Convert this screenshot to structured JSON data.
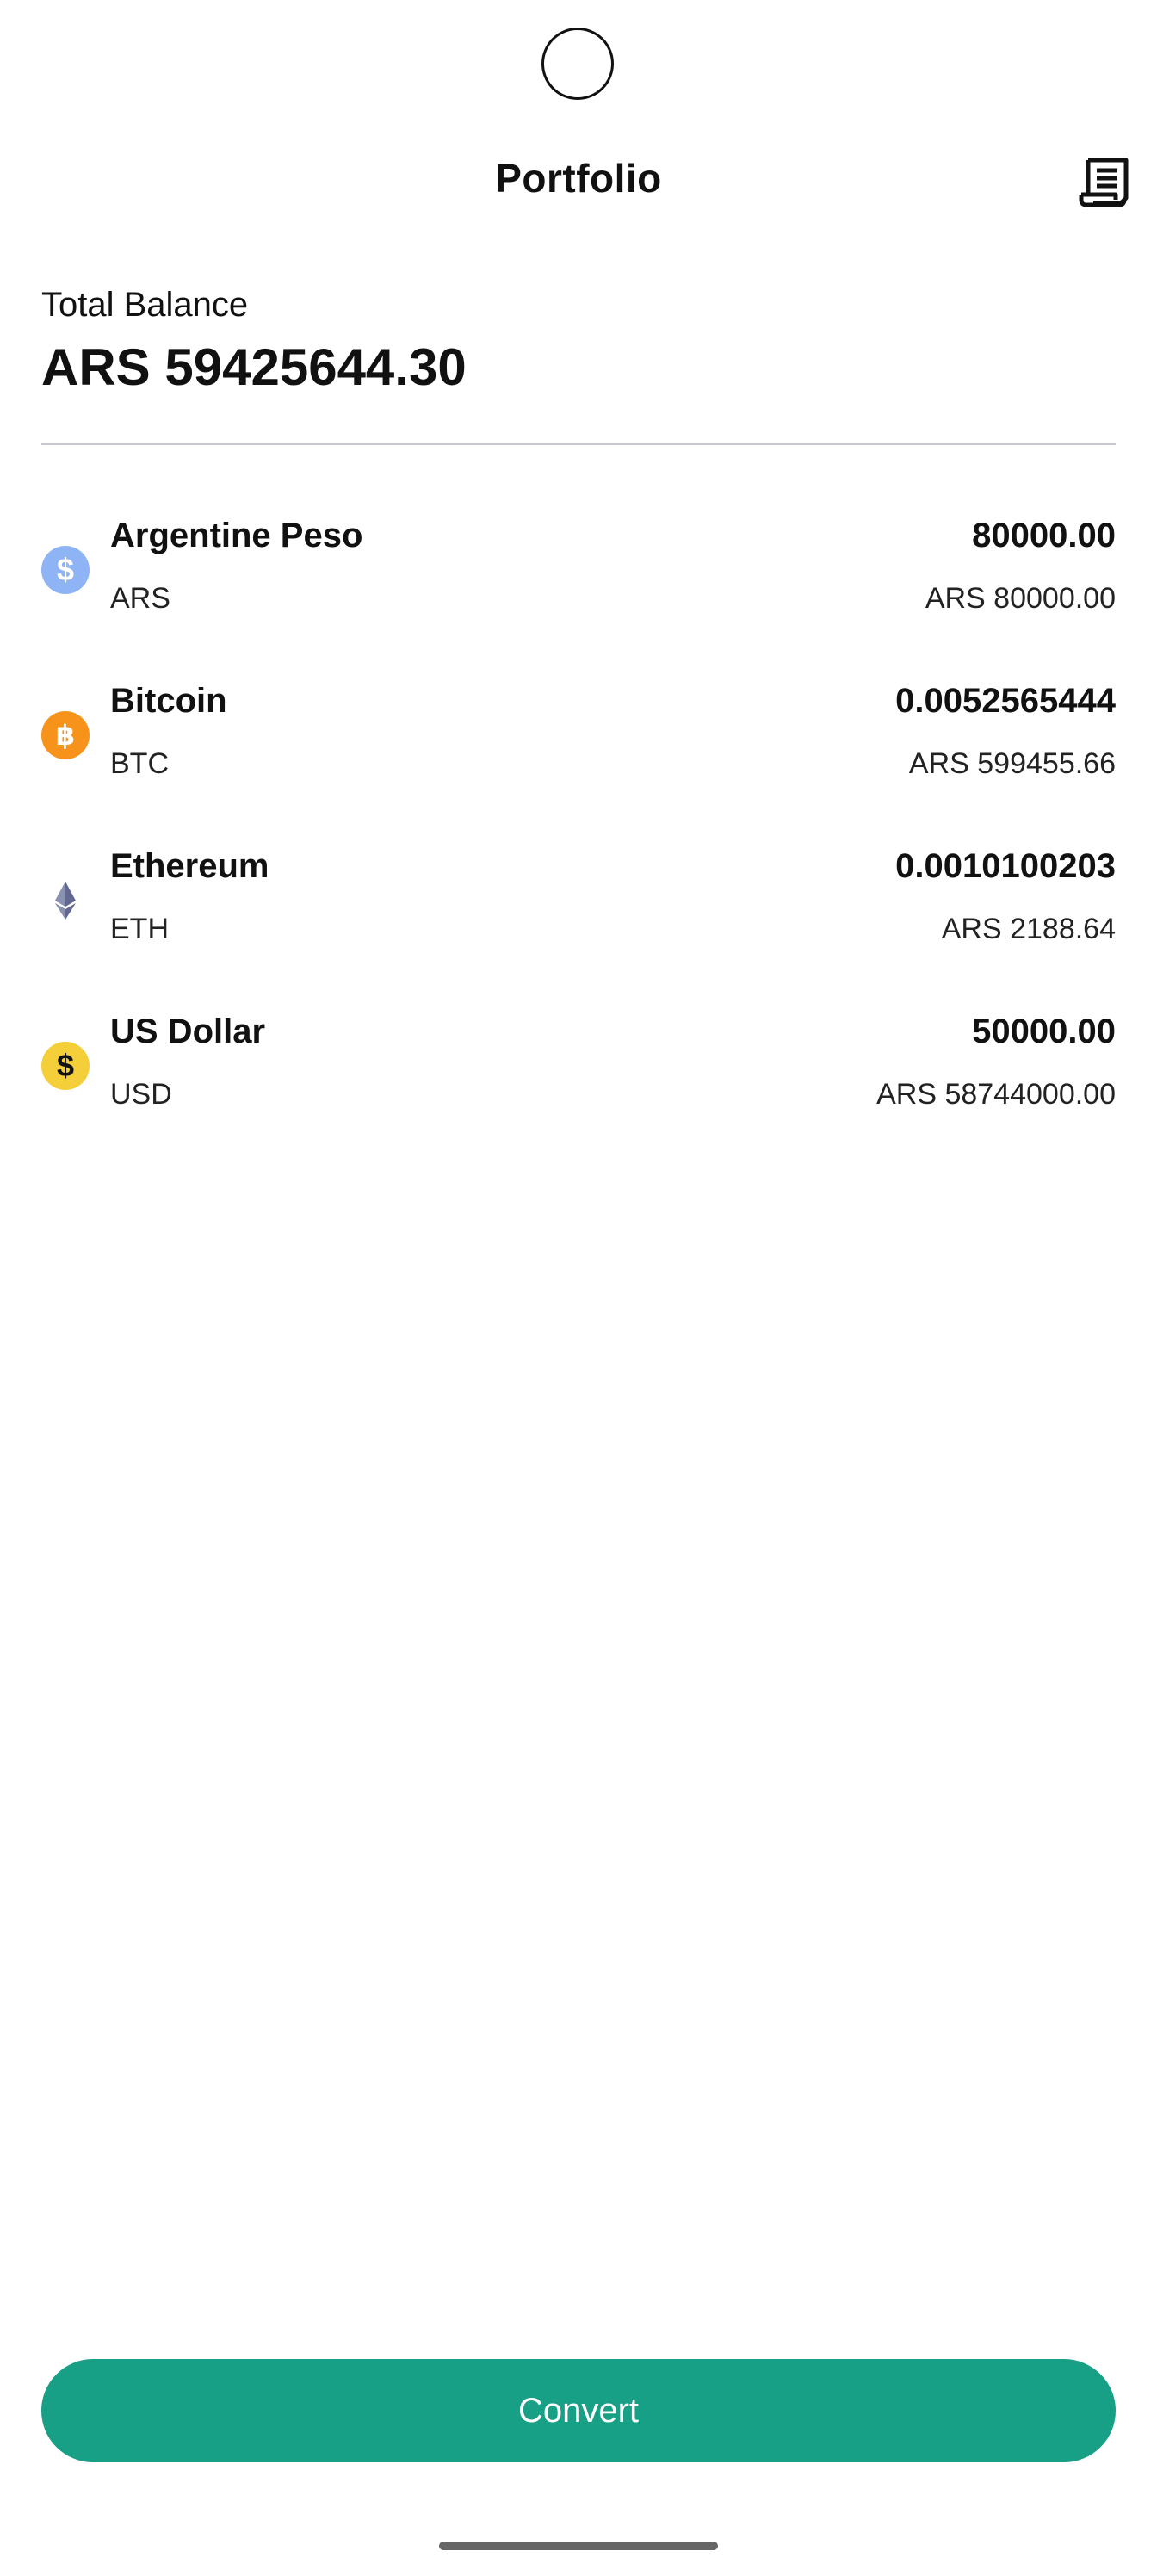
{
  "header": {
    "title": "Portfolio",
    "receipt_icon": "receipt-icon"
  },
  "balance": {
    "label": "Total Balance",
    "value": "ARS 59425644.30"
  },
  "assets": [
    {
      "name": "Argentine Peso",
      "code": "ARS",
      "amount": "80000.00",
      "fiat": "ARS 80000.00",
      "icon": "peso-coin-icon",
      "icon_color": "#8fb4f5"
    },
    {
      "name": "Bitcoin",
      "code": "BTC",
      "amount": "0.0052565444",
      "fiat": "ARS 599455.66",
      "icon": "bitcoin-icon",
      "icon_color": "#f7931a"
    },
    {
      "name": "Ethereum",
      "code": "ETH",
      "amount": "0.0010100203",
      "fiat": "ARS 2188.64",
      "icon": "ethereum-icon",
      "icon_color": "#6b6f8f"
    },
    {
      "name": "US Dollar",
      "code": "USD",
      "amount": "50000.00",
      "fiat": "ARS 58744000.00",
      "icon": "dollar-coin-icon",
      "icon_color": "#f5cf3a"
    }
  ],
  "actions": {
    "convert_label": "Convert",
    "convert_color": "#18a086"
  }
}
